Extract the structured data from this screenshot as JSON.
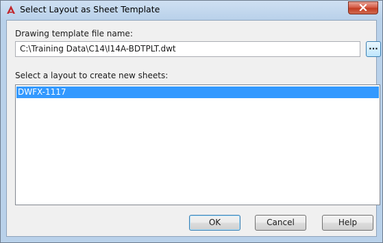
{
  "window": {
    "title": "Select Layout as Sheet Template",
    "app_icon": "autocad-logo-icon",
    "close_label": "X"
  },
  "template": {
    "label": "Drawing template file name:",
    "path": "C:\\Training Data\\C14\\I14A-BDTPLT.dwt",
    "browse_label": "..."
  },
  "layouts": {
    "label": "Select a layout to create new sheets:",
    "items": [
      "DWFX-1117"
    ],
    "selected": "DWFX-1117"
  },
  "buttons": {
    "ok": "OK",
    "cancel": "Cancel",
    "help": "Help"
  },
  "colors": {
    "selection": "#3399ff",
    "title_bar": "#b9d1ea",
    "close_button": "#c23a20"
  }
}
